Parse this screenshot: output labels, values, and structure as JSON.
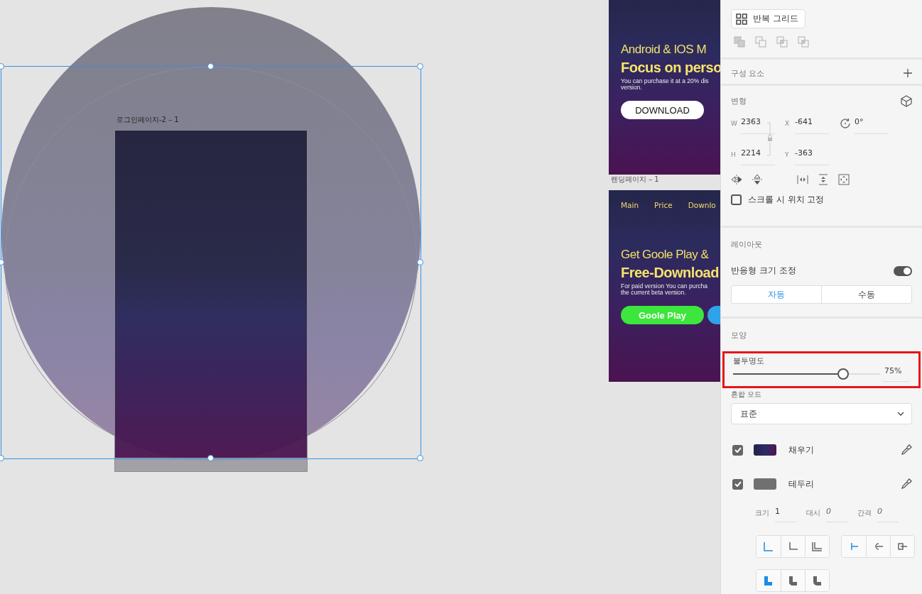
{
  "canvas": {
    "selected_shape": {
      "artboard_title": "로그인페이지-2 – 1"
    },
    "landing_artboards": [
      {
        "headline": "Android & IOS M",
        "subheadline": "Focus on perso",
        "body": "You can purchase it at a 20% dis\nversion.",
        "buttons": [
          {
            "label": "DOWNLOAD",
            "color": "#ffffff"
          }
        ]
      },
      {
        "title": "렌딩페이지 – 1",
        "nav": [
          "Main",
          "Price",
          "Downlo"
        ],
        "headline": "Get Goole Play &",
        "subheadline": "Free-Download",
        "body": "For paid version You can purcha\nthe current beta version.",
        "buttons": [
          {
            "label": "Goole Play",
            "color": "#3ce63c"
          },
          {
            "color": "#2fa3e8"
          }
        ]
      }
    ]
  },
  "panel": {
    "repeat_grid_button": "반복 그리드",
    "components": {
      "title": "구성 요소"
    },
    "transform": {
      "title": "변형",
      "fields": [
        {
          "kind": "size",
          "label": "W",
          "value": "2363"
        },
        {
          "kind": "position",
          "label": "X",
          "value": "-641"
        },
        {
          "kind": "rotation",
          "value": "0°"
        },
        {
          "kind": "size",
          "label": "H",
          "value": "2214"
        },
        {
          "kind": "position",
          "label": "Y",
          "value": "-363"
        }
      ],
      "fix_position": {
        "label": "스크롤 시 위치 고정",
        "checked": false
      }
    },
    "layout": {
      "title": "레이아웃",
      "responsive": {
        "label": "반응형 크기 조정",
        "on": true
      },
      "modes": [
        {
          "label": "자동",
          "selected": true
        },
        {
          "label": "수동",
          "selected": false
        }
      ]
    },
    "appearance": {
      "title": "모양",
      "opacity": {
        "label": "불투명도",
        "level": 0.75,
        "reading": "75%",
        "highlighted": true
      },
      "blend_mode": {
        "label": "혼합 모드",
        "value": "표준"
      },
      "paints": [
        {
          "kind": "fill",
          "label": "채우기",
          "checked": true
        },
        {
          "kind": "border",
          "label": "테두리",
          "checked": true
        }
      ],
      "stroke": [
        {
          "label": "크기",
          "value": "1"
        },
        {
          "label": "대시",
          "value": "0"
        },
        {
          "label": "간격",
          "value": "0"
        }
      ],
      "button_groups": [
        [
          {
            "selected": true
          },
          {
            "selected": false
          },
          {
            "selected": false
          }
        ],
        [
          {
            "selected": true
          },
          {
            "selected": false
          },
          {
            "selected": false
          }
        ],
        [
          {
            "selected": true
          },
          {
            "selected": false
          },
          {
            "selected": false
          }
        ]
      ]
    }
  }
}
